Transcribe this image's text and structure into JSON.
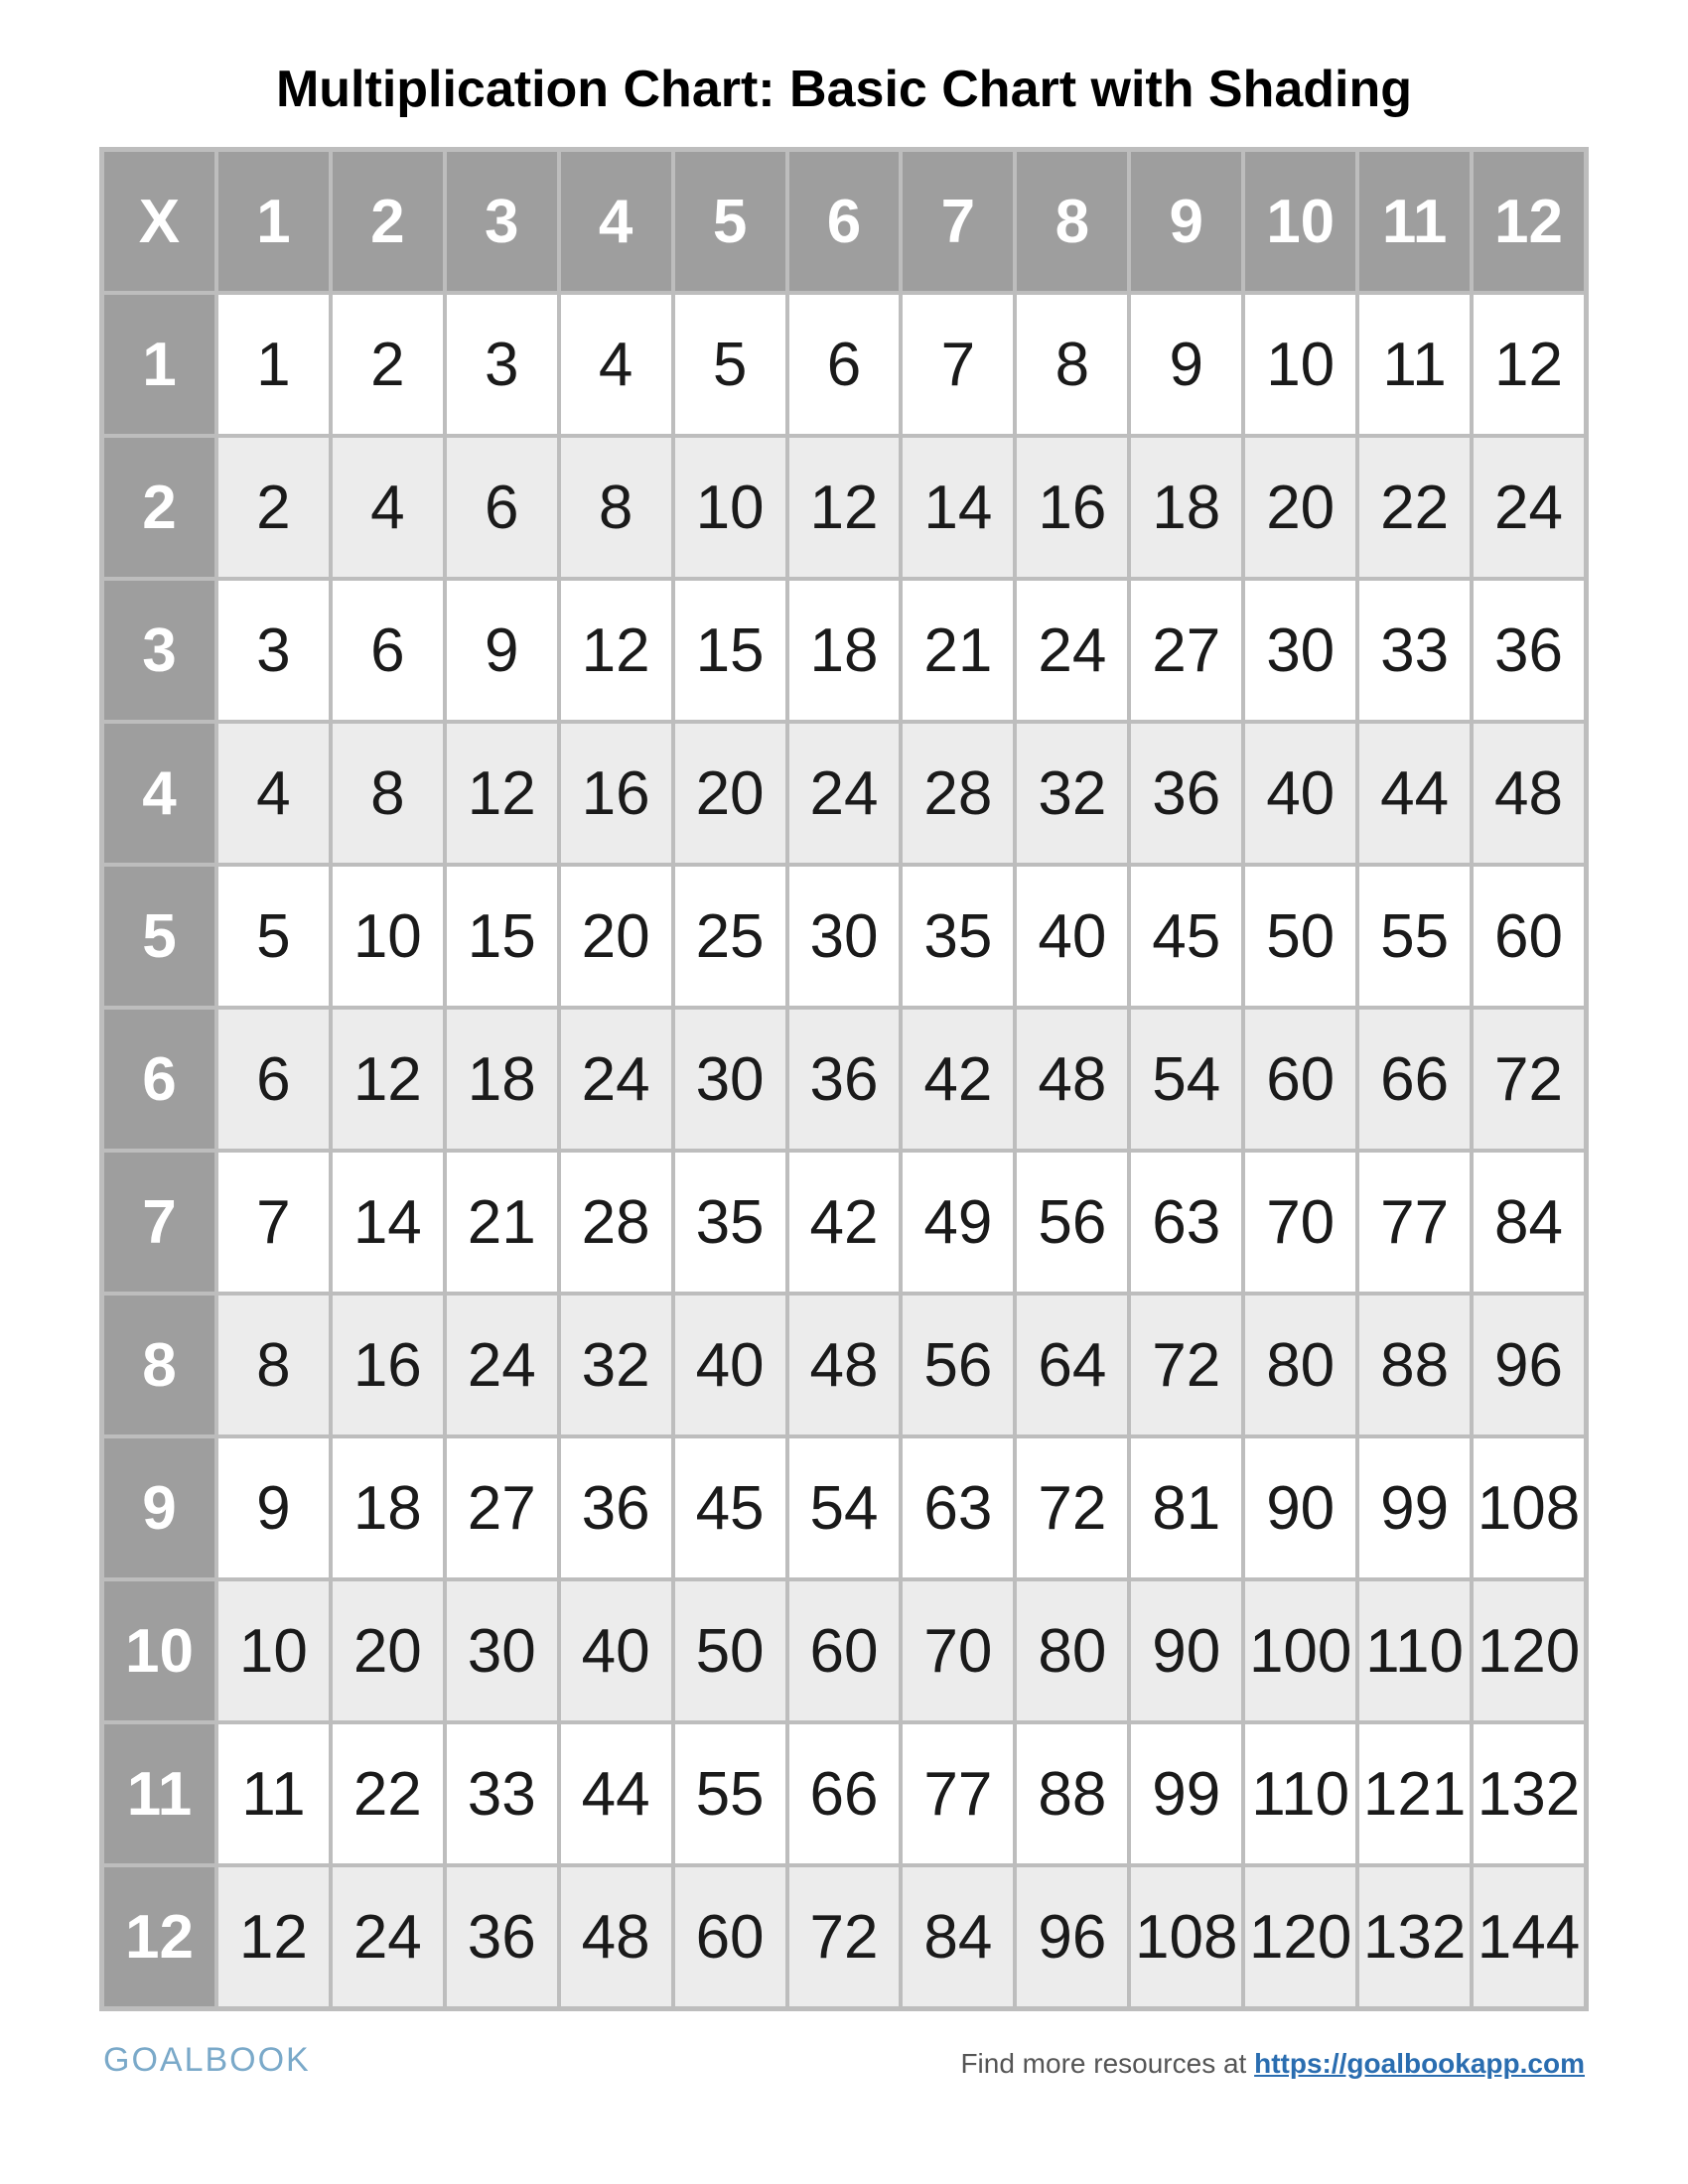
{
  "title": "Multiplication Chart: Basic Chart with Shading",
  "corner": "X",
  "col_headers": [
    "1",
    "2",
    "3",
    "4",
    "5",
    "6",
    "7",
    "8",
    "9",
    "10",
    "11",
    "12"
  ],
  "row_headers": [
    "1",
    "2",
    "3",
    "4",
    "5",
    "6",
    "7",
    "8",
    "9",
    "10",
    "11",
    "12"
  ],
  "chart_data": {
    "type": "table",
    "title": "Multiplication Chart: Basic Chart with Shading",
    "categories": [
      "1",
      "2",
      "3",
      "4",
      "5",
      "6",
      "7",
      "8",
      "9",
      "10",
      "11",
      "12"
    ],
    "rows": [
      {
        "name": "1",
        "values": [
          1,
          2,
          3,
          4,
          5,
          6,
          7,
          8,
          9,
          10,
          11,
          12
        ]
      },
      {
        "name": "2",
        "values": [
          2,
          4,
          6,
          8,
          10,
          12,
          14,
          16,
          18,
          20,
          22,
          24
        ]
      },
      {
        "name": "3",
        "values": [
          3,
          6,
          9,
          12,
          15,
          18,
          21,
          24,
          27,
          30,
          33,
          36
        ]
      },
      {
        "name": "4",
        "values": [
          4,
          8,
          12,
          16,
          20,
          24,
          28,
          32,
          36,
          40,
          44,
          48
        ]
      },
      {
        "name": "5",
        "values": [
          5,
          10,
          15,
          20,
          25,
          30,
          35,
          40,
          45,
          50,
          55,
          60
        ]
      },
      {
        "name": "6",
        "values": [
          6,
          12,
          18,
          24,
          30,
          36,
          42,
          48,
          54,
          60,
          66,
          72
        ]
      },
      {
        "name": "7",
        "values": [
          7,
          14,
          21,
          28,
          35,
          42,
          49,
          56,
          63,
          70,
          77,
          84
        ]
      },
      {
        "name": "8",
        "values": [
          8,
          16,
          24,
          32,
          40,
          48,
          56,
          64,
          72,
          80,
          88,
          96
        ]
      },
      {
        "name": "9",
        "values": [
          9,
          18,
          27,
          36,
          45,
          54,
          63,
          72,
          81,
          90,
          99,
          108
        ]
      },
      {
        "name": "10",
        "values": [
          10,
          20,
          30,
          40,
          50,
          60,
          70,
          80,
          90,
          100,
          110,
          120
        ]
      },
      {
        "name": "11",
        "values": [
          11,
          22,
          33,
          44,
          55,
          66,
          77,
          88,
          99,
          110,
          121,
          132
        ]
      },
      {
        "name": "12",
        "values": [
          12,
          24,
          36,
          48,
          60,
          72,
          84,
          96,
          108,
          120,
          132,
          144
        ]
      }
    ]
  },
  "footer": {
    "logo": "GOALBOOK",
    "resources_text": "Find more resources at ",
    "url": "https://goalbookapp.com"
  }
}
